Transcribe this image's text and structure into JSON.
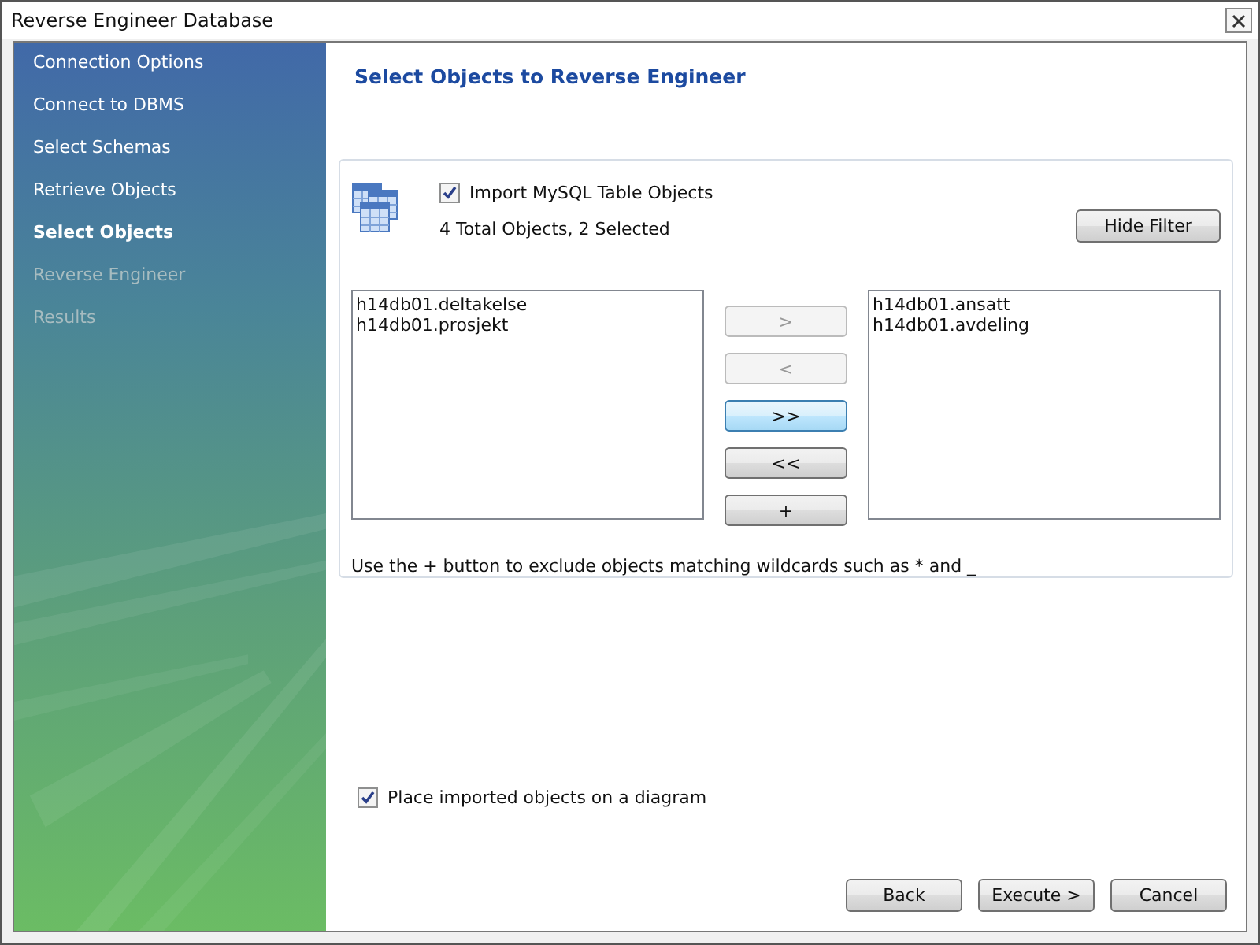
{
  "window": {
    "title": "Reverse Engineer Database"
  },
  "steps": [
    {
      "label": "Connection Options",
      "selected": false,
      "disabled": false
    },
    {
      "label": "Connect to DBMS",
      "selected": false,
      "disabled": false
    },
    {
      "label": "Select Schemas",
      "selected": false,
      "disabled": false
    },
    {
      "label": "Retrieve Objects",
      "selected": false,
      "disabled": false
    },
    {
      "label": "Select Objects",
      "selected": true,
      "disabled": false
    },
    {
      "label": "Reverse Engineer",
      "selected": false,
      "disabled": true
    },
    {
      "label": "Results",
      "selected": false,
      "disabled": true
    }
  ],
  "heading": "Select Objects to Reverse Engineer",
  "filter": {
    "import_label": "Import MySQL Table Objects",
    "import_checked": true,
    "summary": "4 Total Objects, 2 Selected",
    "hide_button": "Hide Filter",
    "available": [
      "h14db01.deltakelse",
      "h14db01.prosjekt"
    ],
    "selected_items": [
      "h14db01.ansatt",
      "h14db01.avdeling"
    ],
    "move_buttons": [
      {
        "label": ">",
        "disabled": true,
        "focused": false
      },
      {
        "label": "<",
        "disabled": true,
        "focused": false
      },
      {
        "label": ">>",
        "disabled": false,
        "focused": true
      },
      {
        "label": "<<",
        "disabled": false,
        "focused": false
      },
      {
        "label": "+",
        "disabled": false,
        "focused": false
      }
    ],
    "hint": "Use the + button to exclude objects matching wildcards such as * and _"
  },
  "place_option": {
    "label": "Place imported objects on a diagram",
    "checked": true
  },
  "buttons": [
    "Back",
    "Execute >",
    "Cancel"
  ]
}
